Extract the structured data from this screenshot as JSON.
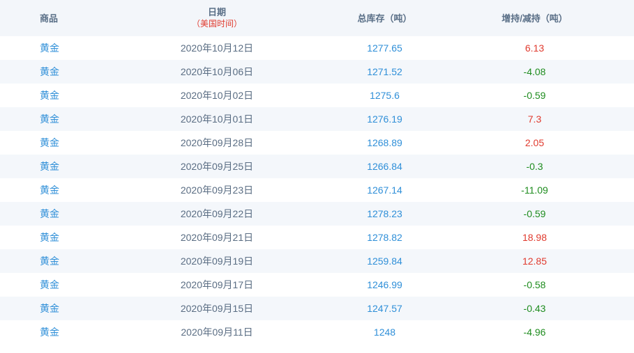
{
  "headers": {
    "commodity": "商品",
    "date": "日期",
    "date_note": "（美国时间）",
    "total": "总库存（吨）",
    "change": "增持/减持（吨）"
  },
  "rows": [
    {
      "commodity": "黄金",
      "date": "2020年10月12日",
      "total": "1277.65",
      "change": "6.13",
      "direction": "up"
    },
    {
      "commodity": "黄金",
      "date": "2020年10月06日",
      "total": "1271.52",
      "change": "-4.08",
      "direction": "down"
    },
    {
      "commodity": "黄金",
      "date": "2020年10月02日",
      "total": "1275.6",
      "change": "-0.59",
      "direction": "down"
    },
    {
      "commodity": "黄金",
      "date": "2020年10月01日",
      "total": "1276.19",
      "change": "7.3",
      "direction": "up"
    },
    {
      "commodity": "黄金",
      "date": "2020年09月28日",
      "total": "1268.89",
      "change": "2.05",
      "direction": "up"
    },
    {
      "commodity": "黄金",
      "date": "2020年09月25日",
      "total": "1266.84",
      "change": "-0.3",
      "direction": "down"
    },
    {
      "commodity": "黄金",
      "date": "2020年09月23日",
      "total": "1267.14",
      "change": "-11.09",
      "direction": "down"
    },
    {
      "commodity": "黄金",
      "date": "2020年09月22日",
      "total": "1278.23",
      "change": "-0.59",
      "direction": "down"
    },
    {
      "commodity": "黄金",
      "date": "2020年09月21日",
      "total": "1278.82",
      "change": "18.98",
      "direction": "up"
    },
    {
      "commodity": "黄金",
      "date": "2020年09月19日",
      "total": "1259.84",
      "change": "12.85",
      "direction": "up"
    },
    {
      "commodity": "黄金",
      "date": "2020年09月17日",
      "total": "1246.99",
      "change": "-0.58",
      "direction": "down"
    },
    {
      "commodity": "黄金",
      "date": "2020年09月15日",
      "total": "1247.57",
      "change": "-0.43",
      "direction": "down"
    },
    {
      "commodity": "黄金",
      "date": "2020年09月11日",
      "total": "1248",
      "change": "-4.96",
      "direction": "down"
    }
  ]
}
